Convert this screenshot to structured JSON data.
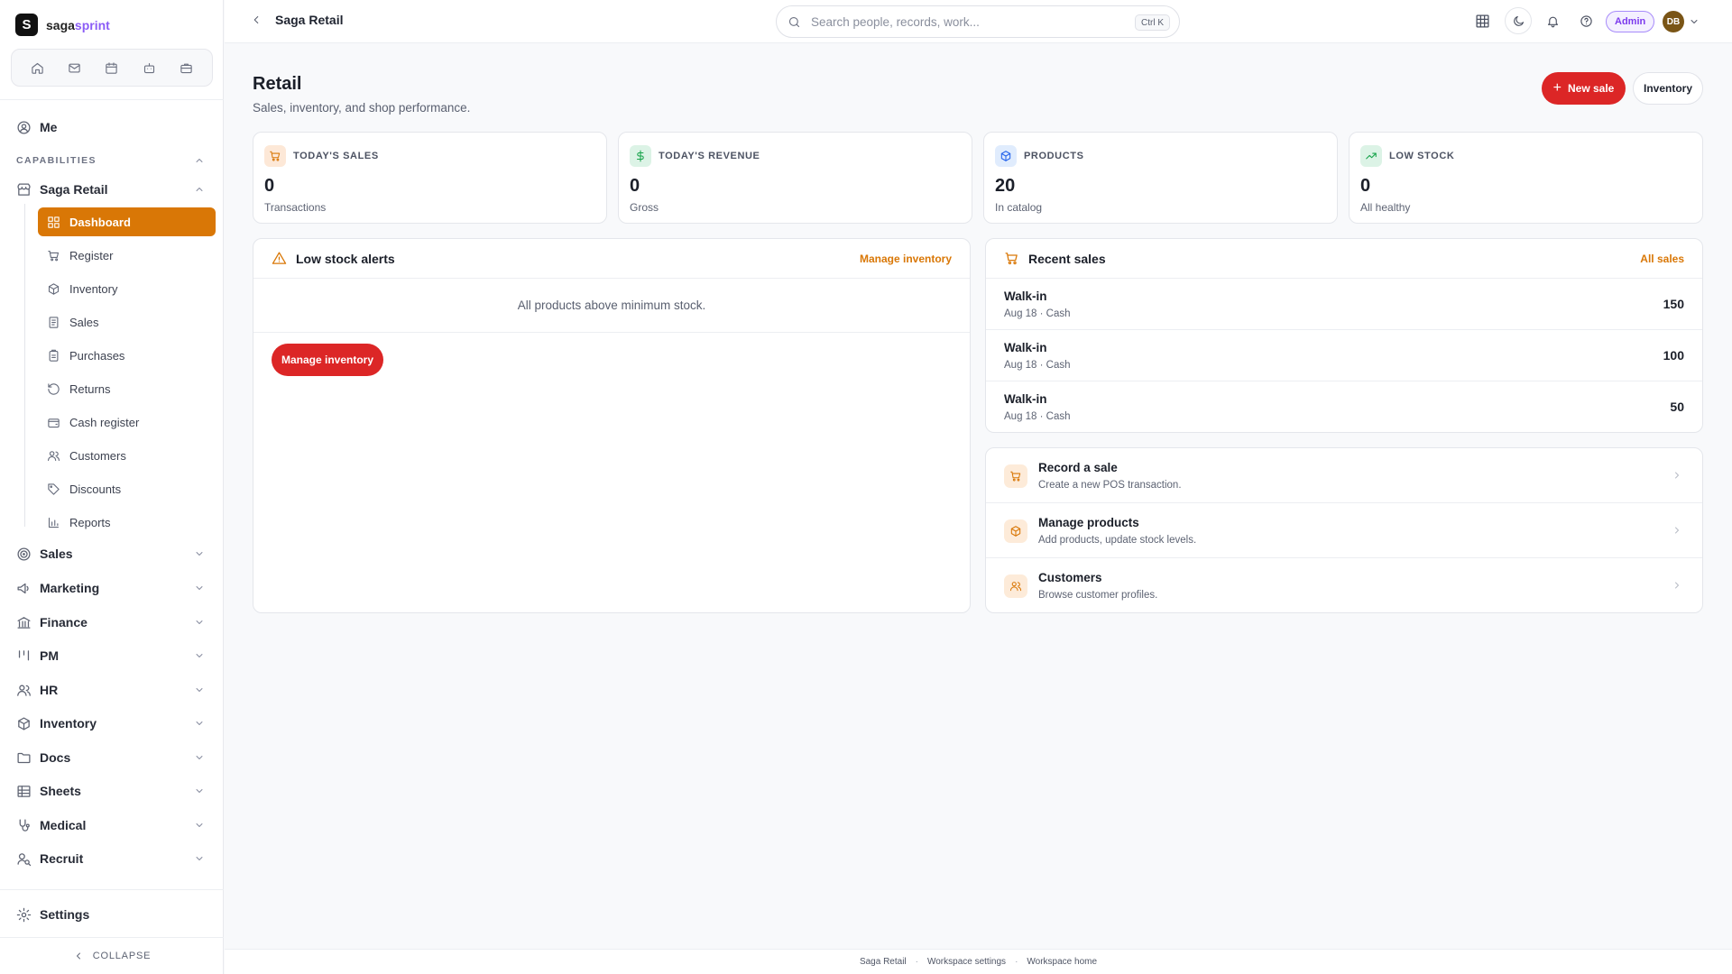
{
  "app": {
    "logo_letter": "S",
    "name_part1": "saga",
    "name_part2": "sprint"
  },
  "quick_icons": [
    "home-icon",
    "mail-icon",
    "calendar-icon",
    "bot-icon",
    "briefcase-icon"
  ],
  "sidebar": {
    "me_label": "Me",
    "section_label": "CAPABILITIES",
    "current_module": "Saga Retail",
    "sub_items": [
      {
        "label": "Dashboard",
        "icon": "dashboard-icon",
        "active": true
      },
      {
        "label": "Register",
        "icon": "cart-icon"
      },
      {
        "label": "Inventory",
        "icon": "box-icon"
      },
      {
        "label": "Sales",
        "icon": "receipt-icon"
      },
      {
        "label": "Purchases",
        "icon": "clipboard-icon"
      },
      {
        "label": "Returns",
        "icon": "rotate-icon"
      },
      {
        "label": "Cash register",
        "icon": "wallet-icon"
      },
      {
        "label": "Customers",
        "icon": "users-icon"
      },
      {
        "label": "Discounts",
        "icon": "tag-icon"
      },
      {
        "label": "Reports",
        "icon": "bar-chart-icon"
      }
    ],
    "modules": [
      {
        "label": "Sales",
        "icon": "target-icon"
      },
      {
        "label": "Marketing",
        "icon": "megaphone-icon"
      },
      {
        "label": "Finance",
        "icon": "bank-icon"
      },
      {
        "label": "PM",
        "icon": "kanban-icon"
      },
      {
        "label": "HR",
        "icon": "users-icon"
      },
      {
        "label": "Inventory",
        "icon": "box-icon"
      },
      {
        "label": "Docs",
        "icon": "folder-icon"
      },
      {
        "label": "Sheets",
        "icon": "table-icon"
      },
      {
        "label": "Medical",
        "icon": "stethoscope-icon"
      },
      {
        "label": "Recruit",
        "icon": "user-search-icon"
      }
    ],
    "settings_label": "Settings",
    "collapse_label": "COLLAPSE"
  },
  "topbar": {
    "breadcrumb": "Saga Retail",
    "search_placeholder": "Search people, records, work...",
    "search_shortcut": "Ctrl K",
    "role_badge": "Admin",
    "avatar_initials": "DB"
  },
  "page": {
    "title": "Retail",
    "subtitle": "Sales, inventory, and shop performance.",
    "primary_action": "New sale",
    "secondary_action": "Inventory"
  },
  "stats": [
    {
      "label": "TODAY'S SALES",
      "value": "0",
      "caption": "Transactions",
      "icon": "cart-icon",
      "chip_bg": "#fde8d7",
      "chip_fg": "#d97706"
    },
    {
      "label": "TODAY'S REVENUE",
      "value": "0",
      "caption": "Gross",
      "icon": "dollar-icon",
      "chip_bg": "#dcf3e6",
      "chip_fg": "#16a34a"
    },
    {
      "label": "PRODUCTS",
      "value": "20",
      "caption": "In catalog",
      "icon": "box-icon",
      "chip_bg": "#e0ecfd",
      "chip_fg": "#2563eb"
    },
    {
      "label": "LOW STOCK",
      "value": "0",
      "caption": "All healthy",
      "icon": "trend-icon",
      "chip_bg": "#dcf3e6",
      "chip_fg": "#16a34a"
    }
  ],
  "low_stock": {
    "title": "Low stock alerts",
    "link": "Manage inventory",
    "empty_message": "All products above minimum stock.",
    "button": "Manage inventory"
  },
  "recent_sales": {
    "title": "Recent sales",
    "link": "All sales",
    "rows": [
      {
        "name": "Walk-in",
        "meta": "Aug 18 · Cash",
        "amount": "150"
      },
      {
        "name": "Walk-in",
        "meta": "Aug 18 · Cash",
        "amount": "100"
      },
      {
        "name": "Walk-in",
        "meta": "Aug 18 · Cash",
        "amount": "50"
      }
    ]
  },
  "quick_actions": [
    {
      "title": "Record a sale",
      "desc": "Create a new POS transaction.",
      "icon": "cart-icon"
    },
    {
      "title": "Manage products",
      "desc": "Add products, update stock levels.",
      "icon": "box-icon"
    },
    {
      "title": "Customers",
      "desc": "Browse customer profiles.",
      "icon": "users-icon"
    }
  ],
  "footer": {
    "links": [
      "Saga Retail",
      "Workspace settings",
      "Workspace home"
    ]
  },
  "colors": {
    "accent": "#d97706",
    "danger": "#dc2626",
    "brand": "#8b5cf6"
  }
}
